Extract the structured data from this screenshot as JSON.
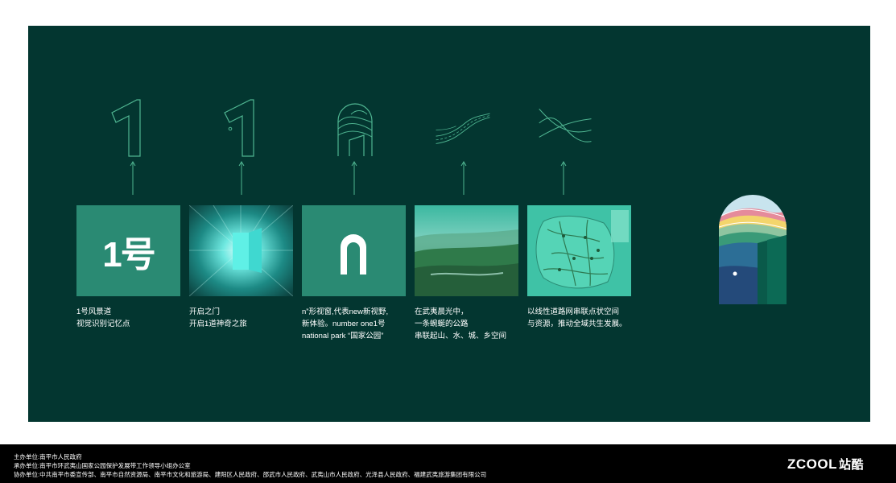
{
  "colors": {
    "panel_bg": "#033630",
    "accent": "#4fb591",
    "tile_green": "#2a8a73",
    "footer_bg": "#000000"
  },
  "icons": [
    "numeral-one-outline-icon",
    "door-numeral-one-icon",
    "arch-window-door-icon",
    "winding-road-icon",
    "crossing-lines-icon"
  ],
  "tiles": [
    {
      "text": "1号"
    },
    {
      "image": "glowing-door-photo"
    },
    {
      "image": "n-arch-shape"
    },
    {
      "image": "misty-mountain-valley-photo"
    },
    {
      "image": "road-network-map"
    }
  ],
  "captions": [
    "1号风景道\n视觉识别记忆点",
    "开启之门\n开启1道神奇之旅",
    "  n”形视窗,代表new新视野,\n新体验。number one1号\nnational park “国家公园”",
    "在武夷晨光中，\n一条蜿蜒的公路\n串联起山、水、城、乡空间",
    "以线性道路网串联点状空间\n与资源，推动全域共生发展。"
  ],
  "footer": {
    "line1": "主办单位:南平市人民政府",
    "line2": "承办单位:南平市环武夷山国家公园保护发展带工作领导小组办公室",
    "line3": "协办单位:中共南平市委宣传部、南平市自然资源局、南平市文化和旅游局、建阳区人民政府、邵武市人民政府、武夷山市人民政府、光泽县人民政府、福建武夷旅游集团有限公司",
    "brand": "ZCOOL",
    "brand_cn": "站酷"
  }
}
